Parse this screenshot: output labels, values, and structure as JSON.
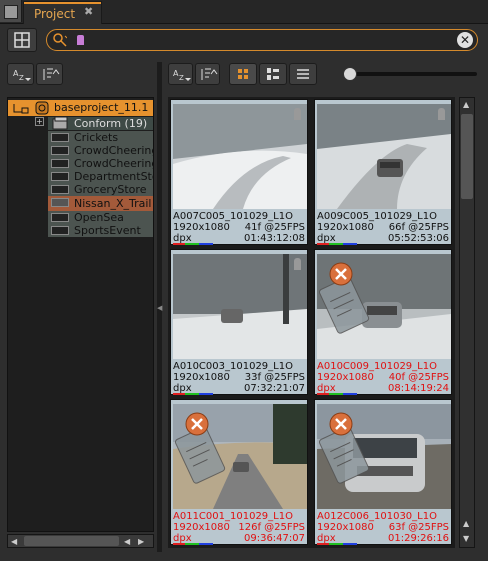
{
  "tab": {
    "title": "Project",
    "close": "✖"
  },
  "search": {
    "clear": "✕"
  },
  "tree": {
    "root": "baseproject_11.1",
    "items": [
      {
        "label": "Conform (19)"
      },
      {
        "label": "Crickets"
      },
      {
        "label": "CrowdCheering"
      },
      {
        "label": "CrowdCheering"
      },
      {
        "label": "DepartmentStore"
      },
      {
        "label": "GroceryStore"
      },
      {
        "label": "Nissan_X_Trail"
      },
      {
        "label": "OpenSea"
      },
      {
        "label": "SportsEvent"
      }
    ]
  },
  "clips": [
    {
      "name": "A007C005_101029_L1O",
      "res": "1920x1080",
      "len": "41f @25FPS",
      "fmt": "dpx",
      "tc": "01:43:12:08",
      "offline": false,
      "scene": "snow"
    },
    {
      "name": "A009C005_101029_L1O",
      "res": "1920x1080",
      "len": "66f @25FPS",
      "fmt": "dpx",
      "tc": "05:52:53:06",
      "offline": false,
      "scene": "snowcar"
    },
    {
      "name": "A010C003_101029_L1O",
      "res": "1920x1080",
      "len": "33f @25FPS",
      "fmt": "dpx",
      "tc": "07:32:21:07",
      "offline": false,
      "scene": "forest"
    },
    {
      "name": "A010C009_101029_L1O",
      "res": "1920x1080",
      "len": "40f @25FPS",
      "fmt": "dpx",
      "tc": "08:14:19:24",
      "offline": true,
      "scene": "forestcar"
    },
    {
      "name": "A011C001_101029_L1O",
      "res": "1920x1080",
      "len": "126f @25FPS",
      "fmt": "dpx",
      "tc": "09:36:47:07",
      "offline": true,
      "scene": "road"
    },
    {
      "name": "A012C006_101030_L1O",
      "res": "1920x1080",
      "len": "63f @25FPS",
      "fmt": "dpx",
      "tc": "01:29:26:16",
      "offline": true,
      "scene": "suv"
    }
  ],
  "colors": {
    "accent": "#e6922e",
    "offline_text": "#e01010",
    "online_text": "#111111",
    "card_bg": "#b9c7cf"
  }
}
